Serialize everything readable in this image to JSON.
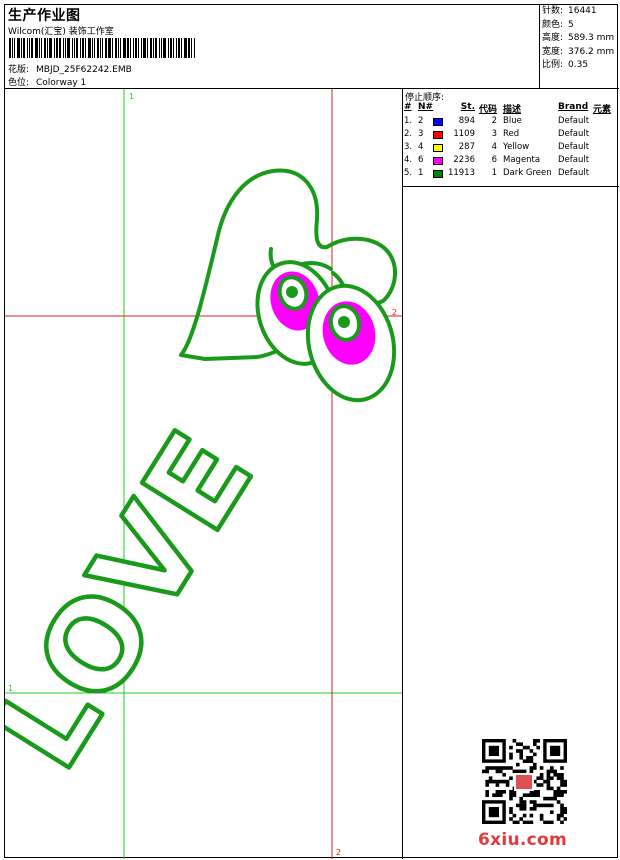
{
  "header": {
    "title": "生产作业图",
    "company": "Wilcom(汇宝) 装饰工作室",
    "design_label": "花版:",
    "design_value": "MBJD_25F62242.EMB",
    "colorway_label": "色位:",
    "colorway_value": "Colorway 1"
  },
  "stats": [
    {
      "label": "针数:",
      "value": "16441"
    },
    {
      "label": "颜色:",
      "value": "5"
    },
    {
      "label": "高度:",
      "value": "589.3 mm"
    },
    {
      "label": "宽度:",
      "value": "376.2 mm"
    },
    {
      "label": "比例:",
      "value": "0.35"
    }
  ],
  "sequence": {
    "title": "停止顺序:",
    "headers": {
      "hash": "#",
      "num": "N#",
      "stitches": "St.",
      "code": "代码",
      "desc": "描述",
      "brand": "Brand",
      "element": "元素"
    },
    "rows": [
      {
        "idx": "1.",
        "n": "2",
        "color": "#0000ff",
        "stitches": "894",
        "code": "2",
        "desc": "Blue",
        "brand": "Default"
      },
      {
        "idx": "2.",
        "n": "3",
        "color": "#ff0000",
        "stitches": "1109",
        "code": "3",
        "desc": "Red",
        "brand": "Default"
      },
      {
        "idx": "3.",
        "n": "4",
        "color": "#ffff00",
        "stitches": "287",
        "code": "4",
        "desc": "Yellow",
        "brand": "Default"
      },
      {
        "idx": "4.",
        "n": "6",
        "color": "#ff00ff",
        "stitches": "2236",
        "code": "6",
        "desc": "Magenta",
        "brand": "Default"
      },
      {
        "idx": "5.",
        "n": "1",
        "color": "#008000",
        "stitches": "11913",
        "code": "1",
        "desc": "Dark Green",
        "brand": "Default"
      }
    ]
  },
  "guides": {
    "v1_label": "1",
    "h1_label": "1",
    "h2_label": "2",
    "v2_label": "2",
    "v1_color": "#22cc22",
    "h1_color": "#22cc22",
    "v2_color": "#dd2222",
    "h2_color": "#dd2222"
  },
  "design_art": {
    "word": "LOVE",
    "thread_color": "#1a9a1a",
    "iris_color": "#ff00ff",
    "pupil_color": "#1a9a1a"
  },
  "watermark": "6xiu.com"
}
